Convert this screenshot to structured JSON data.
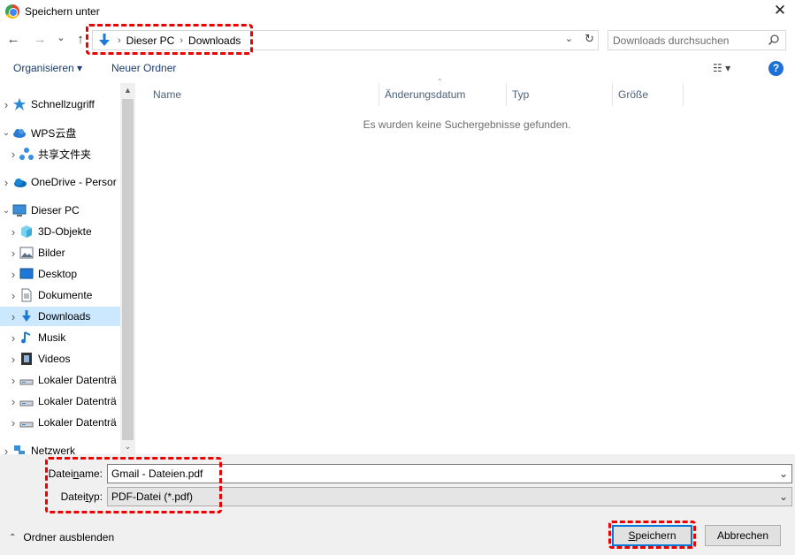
{
  "window": {
    "title": "Speichern unter",
    "close_glyph": "✕"
  },
  "nav": {
    "back_glyph": "←",
    "forward_glyph": "→",
    "recent_glyph": "⌄",
    "up_glyph": "↑",
    "breadcrumbs": [
      "Dieser PC",
      "Downloads"
    ],
    "breadcrumb_sep": "›",
    "address_dropdown_glyph": "⌄",
    "refresh_glyph": "↻",
    "search_placeholder": "Downloads durchsuchen"
  },
  "toolbar": {
    "organize_label": "Organisieren ▾",
    "new_folder_label": "Neuer Ordner",
    "view_label": "☷ ▾",
    "help_label": "?"
  },
  "tree": {
    "items": [
      {
        "label": "Schnellzugriff",
        "icon": "star-icon",
        "chevron": "›",
        "selected": false
      },
      {
        "label": "WPS云盘",
        "icon": "cloud-icon",
        "chevron": "⌄",
        "selected": false
      },
      {
        "label": "共享文件夹",
        "icon": "share-icon",
        "chevron": "›",
        "selected": false
      },
      {
        "label": "OneDrive - Persor",
        "icon": "onedrive-icon",
        "chevron": "›",
        "selected": false
      },
      {
        "label": "Dieser PC",
        "icon": "monitor-icon",
        "chevron": "⌄",
        "selected": false
      },
      {
        "label": "3D-Objekte",
        "icon": "cube-icon",
        "chevron": "›",
        "selected": false
      },
      {
        "label": "Bilder",
        "icon": "picture-icon",
        "chevron": "›",
        "selected": false
      },
      {
        "label": "Desktop",
        "icon": "desktop-icon",
        "chevron": "›",
        "selected": false
      },
      {
        "label": "Dokumente",
        "icon": "document-icon",
        "chevron": "›",
        "selected": false
      },
      {
        "label": "Downloads",
        "icon": "download-icon",
        "chevron": "›",
        "selected": true
      },
      {
        "label": "Musik",
        "icon": "music-icon",
        "chevron": "›",
        "selected": false
      },
      {
        "label": "Videos",
        "icon": "video-icon",
        "chevron": "›",
        "selected": false
      },
      {
        "label": "Lokaler Datenträ",
        "icon": "drive-icon",
        "chevron": "›",
        "selected": false
      },
      {
        "label": "Lokaler Datenträ",
        "icon": "drive-icon",
        "chevron": "›",
        "selected": false
      },
      {
        "label": "Lokaler Datenträ",
        "icon": "drive-icon",
        "chevron": "›",
        "selected": false
      },
      {
        "label": "Netzwerk",
        "icon": "network-icon",
        "chevron": "›",
        "selected": false
      }
    ],
    "scroll_up_glyph": "▲",
    "scroll_down_glyph": "⌄"
  },
  "files": {
    "columns": [
      "Name",
      "Änderungsdatum",
      "Typ",
      "Größe"
    ],
    "empty_message": "Es wurden keine Suchergebnisse gefunden.",
    "sort_caret": "⌃"
  },
  "form": {
    "filename_label_pre": "Datei",
    "filename_label_u": "n",
    "filename_label_post": "ame:",
    "filename_value": "Gmail - Dateien.pdf",
    "filetype_label_pre": "Datei",
    "filetype_label_u": "t",
    "filetype_label_post": "yp:",
    "filetype_value": "PDF-Datei (*.pdf)",
    "dropdown_glyph": "⌄"
  },
  "footer": {
    "hide_folders_glyph": "⌃",
    "hide_folders_label": "Ordner ausblenden",
    "save_label_u": "S",
    "save_label_rest": "peichern",
    "cancel_label": "Abbrechen"
  },
  "colors": {
    "highlight": "#e00000",
    "selected_item": "#cce8ff",
    "primary_button_border": "#0078d7",
    "help_blue": "#1e70d6"
  }
}
